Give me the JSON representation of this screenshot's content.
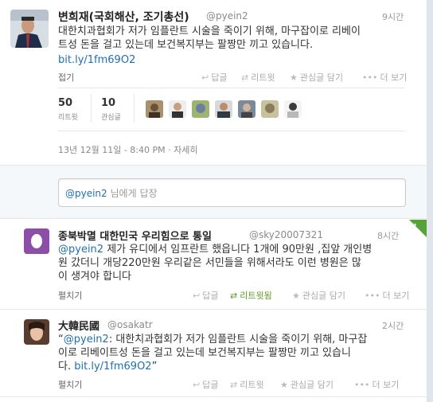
{
  "tweet1": {
    "name": "변희재(국회해산, 조기총선)",
    "handle": "@pyein2",
    "time": "9시간",
    "text_line1": "대한치과협회가 저가 임플란트 시술을 죽이기 위해, 마구잡이로 리베이",
    "text_line2": "트성 돈을 걸고 있는데 보건복지부는 팔짱만 끼고 있습니다.",
    "link": "bit.ly/1fm69O2",
    "collapse": "접기",
    "actions": {
      "reply": "답글",
      "retweet": "리트윗",
      "favorite": "관심글 담기",
      "more": "더 보기"
    },
    "stats": {
      "retweets_count": "50",
      "retweets_label": "리트윗",
      "favorites_count": "10",
      "favorites_label": "관심글"
    },
    "timestamp": "13년 12월 11일 - 8:40 PM",
    "details": "자세히"
  },
  "reply": {
    "mention": "@pyein2",
    "placeholder": "님에게 답장"
  },
  "tweet2": {
    "name": "종북박멸 대한민국 우리힘으로 통일",
    "handle": "@sky20007321",
    "time": "8시간",
    "mention": "@pyein2",
    "text_line1": " 제가 유디에서 임프란트 했읍니다 1개에 90만원 ,집앞 개인병",
    "text_line2": "원 갔더니 개당220만원  우리같은 서민들을 위해서라도 이런 병원은 많",
    "text_line3": "이 생겨야 합니다",
    "expand": "펼치기",
    "actions": {
      "reply": "답글",
      "retweeted": "리트윗됨",
      "favorite": "관심글 담기",
      "more": "더 보기"
    }
  },
  "tweet3": {
    "name": "大韓民國",
    "handle": "@osakatr",
    "time": "2시간",
    "quote_mention": "@pyein2",
    "text_line1": ": 대한치과협회가 저가 임플란트 시술을 죽이기 위해, 마구잡",
    "text_line2": "이로 리베이트성 돈을 걸고 있는데 보건복지부는 팔짱만 끼고 있습니",
    "text_line3_a": "다. ",
    "link": "bit.ly/1fm69O2",
    "open_quote": "“",
    "close_quote": "”",
    "expand": "펼치기",
    "actions": {
      "reply": "답글",
      "retweet": "리트윗",
      "favorite": "관심글 담기",
      "more": "더 보기"
    }
  },
  "colors": {
    "link": "#1f6fb2",
    "retweeted": "#609928",
    "badge": "#56a23a"
  }
}
